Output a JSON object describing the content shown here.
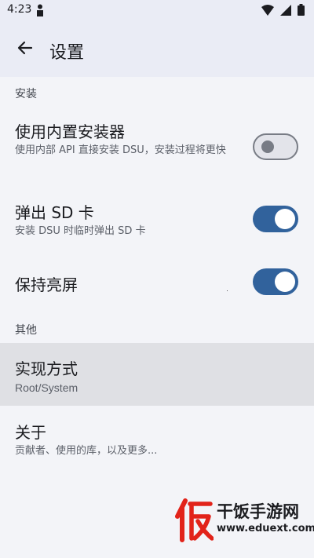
{
  "status_bar": {
    "time": "4:23",
    "icons": [
      "person-icon",
      "wifi-icon",
      "signal-icon",
      "battery-icon"
    ]
  },
  "header": {
    "title": "设置",
    "back_icon": "arrow-left-icon"
  },
  "sections": [
    {
      "header": "安装",
      "items": [
        {
          "title": "使用内置安装器",
          "summary": "使用内部 API 直接安装 DSU，安装过程将更快",
          "toggle": "off"
        },
        {
          "title": "弹出 SD 卡",
          "summary": "安装 DSU 时临时弹出 SD 卡",
          "toggle": "on"
        },
        {
          "title": "保持亮屏",
          "toggle": "on"
        }
      ]
    },
    {
      "header": "其他",
      "items": [
        {
          "title": "实现方式",
          "summary": "Root/System"
        },
        {
          "title": "关于",
          "summary": "贡献者、使用的库，以及更多..."
        }
      ]
    }
  ],
  "watermark": {
    "name": "干饭手游网",
    "url": "www.eduext.com"
  },
  "colors": {
    "background": "#f3f4f8",
    "appbar": "#eaecf5",
    "toggle_on": "#31629c",
    "toggle_off_track": "#e3e4ea",
    "toggle_off_outline": "#787c85",
    "highlight": "#dfe0e4",
    "watermark_red": "#e2231a"
  }
}
